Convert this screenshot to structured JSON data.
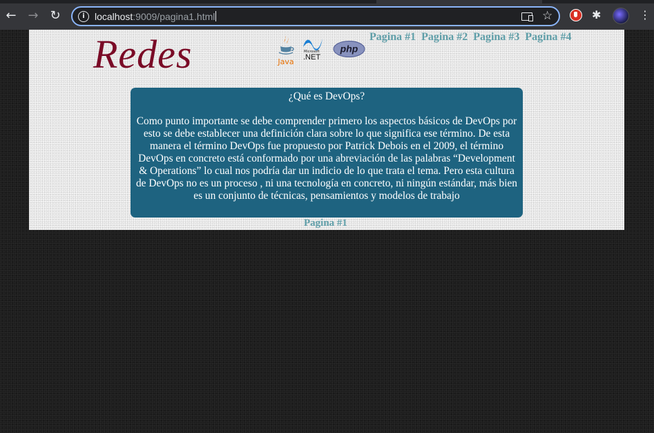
{
  "browser": {
    "url_host": "localhost",
    "url_rest": ":9009/pagina1.html",
    "back_icon": "←",
    "forward_icon": "→",
    "reload_icon": "↻",
    "info_icon": "i",
    "star_icon": "☆",
    "puzzle_icon": "✱",
    "menu_icon": "⋮"
  },
  "page": {
    "title": "Redes",
    "tech_logos": {
      "java": "Java",
      "net_small": "Microsoft",
      "net_big": ".NET",
      "php": "php"
    },
    "nav": [
      "Pagina #1",
      "Pagina #2",
      "Pagina #3",
      "Pagina #4"
    ],
    "card": {
      "question": "¿Qué es DevOps?",
      "body": "Como punto importante se debe comprender primero los aspectos básicos de DevOps por esto se debe establecer una definición clara sobre lo que significa ese término. De esta manera el término DevOps fue propuesto por Patrick Debois en el 2009, el término DevOps en concreto está conformado por una abreviación de las palabras “Development & Operations” lo cual nos podría dar un indicio de lo que trata el tema. Pero esta cultura de DevOps no es un proceso , ni una tecnología en concreto, ni ningún estándar, más bien es un conjunto de técnicas, pensamientos y modelos de trabajo"
    },
    "footer_link": "Pagina #1"
  },
  "colors": {
    "title": "#7a0a26",
    "card_bg": "#1e6380",
    "link": "#5f9ea8",
    "omnibox_border": "#8ab4f8"
  }
}
